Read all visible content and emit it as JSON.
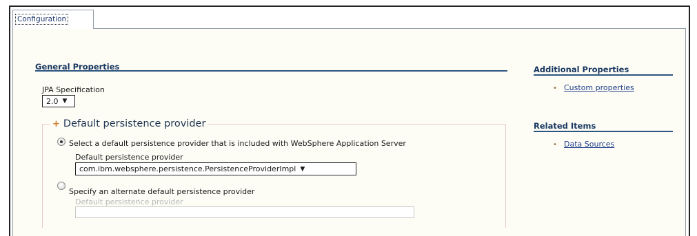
{
  "tabs": [
    {
      "label": "Configuration",
      "active": true
    }
  ],
  "general_properties": {
    "title": "General Properties",
    "jpa_spec": {
      "label": "JPA Specification",
      "selected": "2.0"
    },
    "default_provider": {
      "legend": "Default persistence provider",
      "option_included": {
        "label": "Select a default persistence provider that is included with WebSphere Application Server",
        "checked": true,
        "field_label": "Default persistence provider",
        "selected": "com.ibm.websphere.persistence.PersistenceProviderImpl"
      },
      "option_alternate": {
        "label": "Specify an alternate default persistence provider",
        "checked": false,
        "field_label": "Default persistence provider",
        "value": ""
      }
    }
  },
  "additional_properties": {
    "title": "Additional Properties",
    "links": [
      "Custom properties"
    ]
  },
  "related_items": {
    "title": "Related Items",
    "links": [
      "Data Sources"
    ]
  },
  "colors": {
    "heading": "#18365f",
    "rule": "#2d5580",
    "link": "#1d3c8a",
    "panel_bg": "#fdfdf6"
  }
}
